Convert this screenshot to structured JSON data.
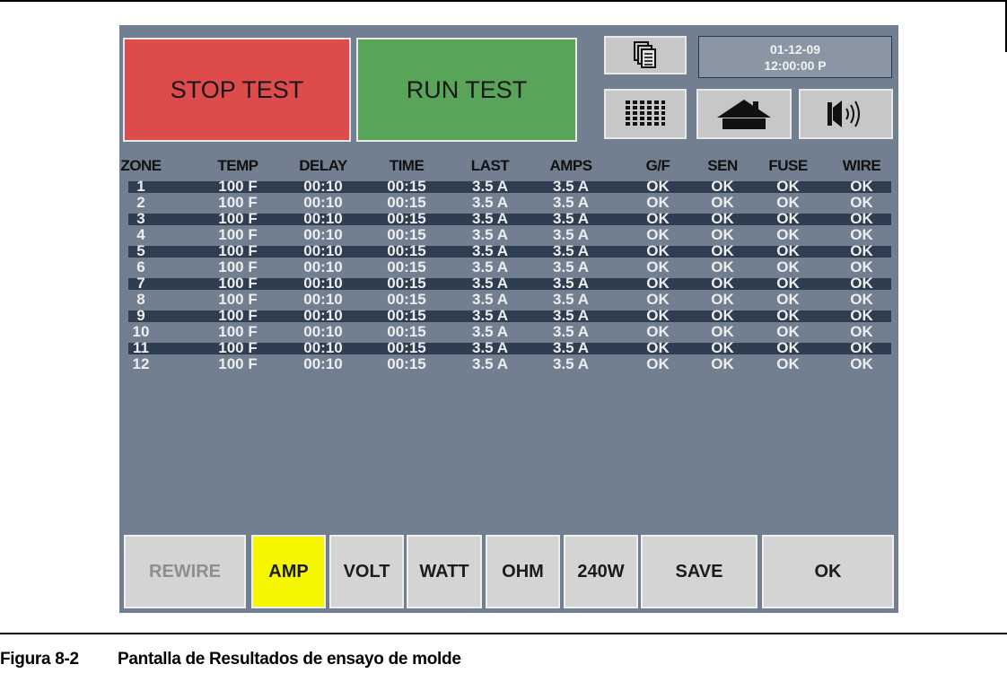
{
  "buttons": {
    "stop_test": "STOP TEST",
    "run_test": "RUN TEST"
  },
  "datetime": {
    "date": "01-12-09",
    "time": "12:00:00 P"
  },
  "icons": [
    "copy-pages-icon",
    "grid-keypad-icon",
    "home-icon",
    "speaker-icon"
  ],
  "table": {
    "columns": [
      "ZONE",
      "TEMP",
      "DELAY",
      "TIME",
      "LAST",
      "AMPS",
      "G/F",
      "SEN",
      "FUSE",
      "WIRE"
    ],
    "rows": [
      [
        "1",
        "100 F",
        "00:10",
        "00:15",
        "3.5 A",
        "3.5 A",
        "OK",
        "OK",
        "OK",
        "OK"
      ],
      [
        "2",
        "100 F",
        "00:10",
        "00:15",
        "3.5 A",
        "3.5 A",
        "OK",
        "OK",
        "OK",
        "OK"
      ],
      [
        "3",
        "100 F",
        "00:10",
        "00:15",
        "3.5 A",
        "3.5 A",
        "OK",
        "OK",
        "OK",
        "OK"
      ],
      [
        "4",
        "100 F",
        "00:10",
        "00:15",
        "3.5 A",
        "3.5 A",
        "OK",
        "OK",
        "OK",
        "OK"
      ],
      [
        "5",
        "100 F",
        "00:10",
        "00:15",
        "3.5 A",
        "3.5 A",
        "OK",
        "OK",
        "OK",
        "OK"
      ],
      [
        "6",
        "100 F",
        "00:10",
        "00:15",
        "3.5 A",
        "3.5 A",
        "OK",
        "OK",
        "OK",
        "OK"
      ],
      [
        "7",
        "100 F",
        "00:10",
        "00:15",
        "3.5 A",
        "3.5 A",
        "OK",
        "OK",
        "OK",
        "OK"
      ],
      [
        "8",
        "100 F",
        "00:10",
        "00:15",
        "3.5 A",
        "3.5 A",
        "OK",
        "OK",
        "OK",
        "OK"
      ],
      [
        "9",
        "100 F",
        "00:10",
        "00:15",
        "3.5 A",
        "3.5 A",
        "OK",
        "OK",
        "OK",
        "OK"
      ],
      [
        "10",
        "100 F",
        "00:10",
        "00:15",
        "3.5 A",
        "3.5 A",
        "OK",
        "OK",
        "OK",
        "OK"
      ],
      [
        "11",
        "100 F",
        "00:10",
        "00:15",
        "3.5 A",
        "3.5 A",
        "OK",
        "OK",
        "OK",
        "OK"
      ],
      [
        "12",
        "100 F",
        "00:10",
        "00:15",
        "3.5 A",
        "3.5 A",
        "OK",
        "OK",
        "OK",
        "OK"
      ]
    ]
  },
  "bottom_buttons": {
    "rewire": "REWIRE",
    "amp": "AMP",
    "volt": "VOLT",
    "watt": "WATT",
    "ohm": "OHM",
    "w240": "240W",
    "save": "SAVE",
    "ok": "OK"
  },
  "caption": {
    "number": "Figura 8-2",
    "text": "Pantalla de Resultados de ensayo de molde"
  },
  "colors": {
    "panel": "#727f91",
    "stop": "#dd4b4b",
    "run": "#58a55a",
    "active_tab": "#f6f600",
    "row_band": "#2f3d51"
  }
}
